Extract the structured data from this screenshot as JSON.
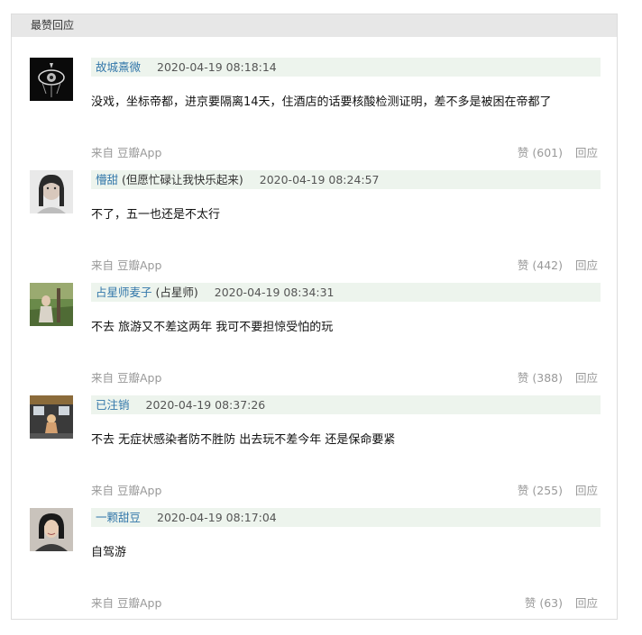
{
  "header": {
    "title": "最赞回应"
  },
  "comments": [
    {
      "author": "故城熹微",
      "signature": "",
      "time": "2020-04-19 08:18:14",
      "text": "没戏，坐标帝都，进京要隔离14天，住酒店的话要核酸检测证明，差不多是被困在帝都了",
      "source": "来自 豆瓣App",
      "vote": "赞 (601)",
      "reply": "回应"
    },
    {
      "author": "懵甜",
      "signature": "(但愿忙碌让我快乐起来)",
      "time": "2020-04-19 08:24:57",
      "text": "不了，五一也还是不太行",
      "source": "来自 豆瓣App",
      "vote": "赞 (442)",
      "reply": "回应"
    },
    {
      "author": "占星师麦子",
      "signature": "(占星师)",
      "time": "2020-04-19 08:34:31",
      "text": "不去 旅游又不差这两年 我可不要担惊受怕的玩",
      "source": "来自 豆瓣App",
      "vote": "赞 (388)",
      "reply": "回应"
    },
    {
      "author": "已注销",
      "signature": "",
      "time": "2020-04-19 08:37:26",
      "text": "不去 无症状感染者防不胜防 出去玩不差今年 还是保命要紧",
      "source": "来自 豆瓣App",
      "vote": "赞 (255)",
      "reply": "回应"
    },
    {
      "author": "一颗甜豆",
      "signature": "",
      "time": "2020-04-19 08:17:04",
      "text": "自驾游",
      "source": "来自 豆瓣App",
      "vote": "赞 (63)",
      "reply": "回应"
    }
  ]
}
